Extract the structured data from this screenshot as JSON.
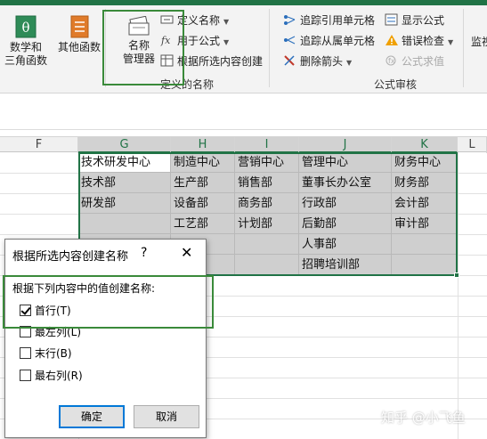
{
  "ribbon": {
    "math_label_1": "数学和",
    "math_label_2": "三角函数",
    "other_label": "其他函数",
    "name_mgr_label_1": "名称",
    "name_mgr_label_2": "管理器",
    "define_name": "定义名称",
    "use_in_formula": "用于公式",
    "create_from_sel": "根据所选内容创建",
    "defined_names_group": "定义的名称",
    "trace_precedents": "追踪引用单元格",
    "trace_dependents": "追踪从属单元格",
    "remove_arrows": "删除箭头",
    "show_formulas": "显示公式",
    "error_checking": "错误检查",
    "evaluate_formula": "公式求值",
    "formula_auditing_group": "公式审核",
    "watch_label": "监视"
  },
  "columns": [
    "F",
    "G",
    "H",
    "I",
    "J",
    "K",
    "L"
  ],
  "cells": [
    [
      "技术研发中心",
      "制造中心",
      "营销中心",
      "管理中心",
      "财务中心"
    ],
    [
      "技术部",
      "生产部",
      "销售部",
      "董事长办公室",
      "财务部"
    ],
    [
      "研发部",
      "设备部",
      "商务部",
      "行政部",
      "会计部"
    ],
    [
      "",
      "工艺部",
      "计划部",
      "后勤部",
      "审计部"
    ],
    [
      "",
      "",
      "",
      "人事部",
      ""
    ],
    [
      "",
      "",
      "",
      "招聘培训部",
      ""
    ]
  ],
  "dialog": {
    "title": "根据所选内容创建名称",
    "help": "?",
    "close": "✕",
    "group_label": "根据下列内容中的值创建名称:",
    "options": [
      {
        "label": "首行(T)",
        "checked": true
      },
      {
        "label": "最左列(L)",
        "checked": false
      },
      {
        "label": "末行(B)",
        "checked": false
      },
      {
        "label": "最右列(R)",
        "checked": false
      }
    ],
    "ok": "确定",
    "cancel": "取消"
  },
  "watermark": "知乎 @小飞鱼",
  "colors": {
    "excel_green": "#217346",
    "highlight_box": "#3a8a3a",
    "selection_gray": "#cfcfcf"
  }
}
